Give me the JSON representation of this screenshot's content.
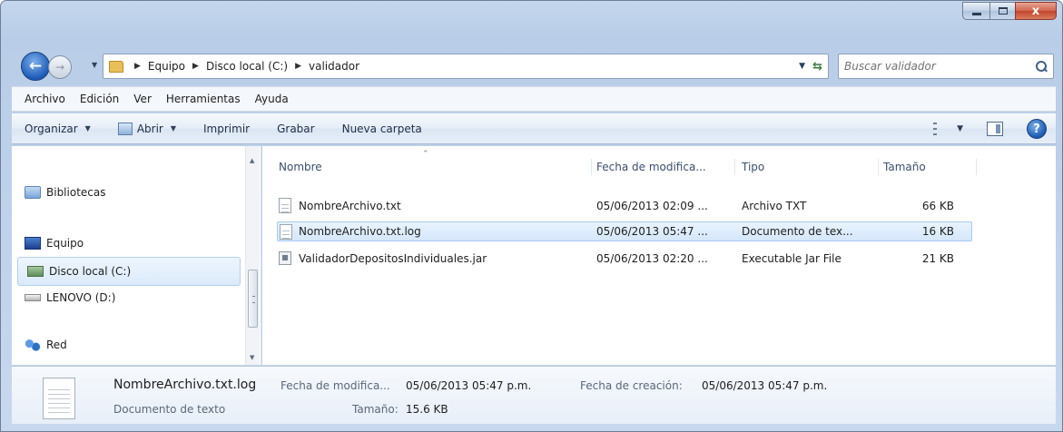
{
  "window": {
    "caption": {
      "minimize": "",
      "maximize": "",
      "close": "x"
    }
  },
  "nav": {
    "back": "←",
    "forward": "→",
    "breadcrumbs": [
      "Equipo",
      "Disco local (C:)",
      "validador"
    ],
    "search_placeholder": "Buscar validador"
  },
  "menu": [
    "Archivo",
    "Edición",
    "Ver",
    "Herramientas",
    "Ayuda"
  ],
  "commands": {
    "organize": "Organizar",
    "open": "Abrir",
    "print": "Imprimir",
    "burn": "Grabar",
    "new_folder": "Nueva carpeta",
    "help": "?"
  },
  "navpane": {
    "items": [
      {
        "label": "Bibliotecas",
        "icon": "libraries-icon"
      },
      {
        "label": "Equipo",
        "icon": "computer-icon"
      },
      {
        "label": "Disco local (C:)",
        "icon": "local-disk-icon",
        "selected": true
      },
      {
        "label": "LENOVO (D:)",
        "icon": "removable-drive-icon"
      },
      {
        "label": "Red",
        "icon": "network-icon"
      }
    ]
  },
  "filelist": {
    "columns": [
      "Nombre",
      "Fecha de modifica...",
      "Tipo",
      "Tamaño"
    ],
    "rows": [
      {
        "name": "NombreArchivo.txt",
        "date": "05/06/2013 02:09 ...",
        "type": "Archivo TXT",
        "size": "66 KB",
        "icon": "text-file-icon"
      },
      {
        "name": "NombreArchivo.txt.log",
        "date": "05/06/2013 05:47 ...",
        "type": "Documento de tex...",
        "size": "16 KB",
        "icon": "text-file-icon",
        "selected": true
      },
      {
        "name": "ValidadorDepositosIndividuales.jar",
        "date": "05/06/2013 02:20 ...",
        "type": "Executable Jar File",
        "size": "21 KB",
        "icon": "jar-file-icon"
      }
    ]
  },
  "details": {
    "name": "NombreArchivo.txt.log",
    "type": "Documento de texto",
    "modified_label": "Fecha de modifica...",
    "modified_value": "05/06/2013 05:47 p.m.",
    "size_label": "Tamaño:",
    "size_value": "15.6 KB",
    "created_label": "Fecha de creación:",
    "created_value": "05/06/2013 05:47 p.m."
  },
  "colors": {
    "selection": "#d5e7fb",
    "selection_border": "#a8c9ef",
    "frame": "#b9cde8"
  }
}
